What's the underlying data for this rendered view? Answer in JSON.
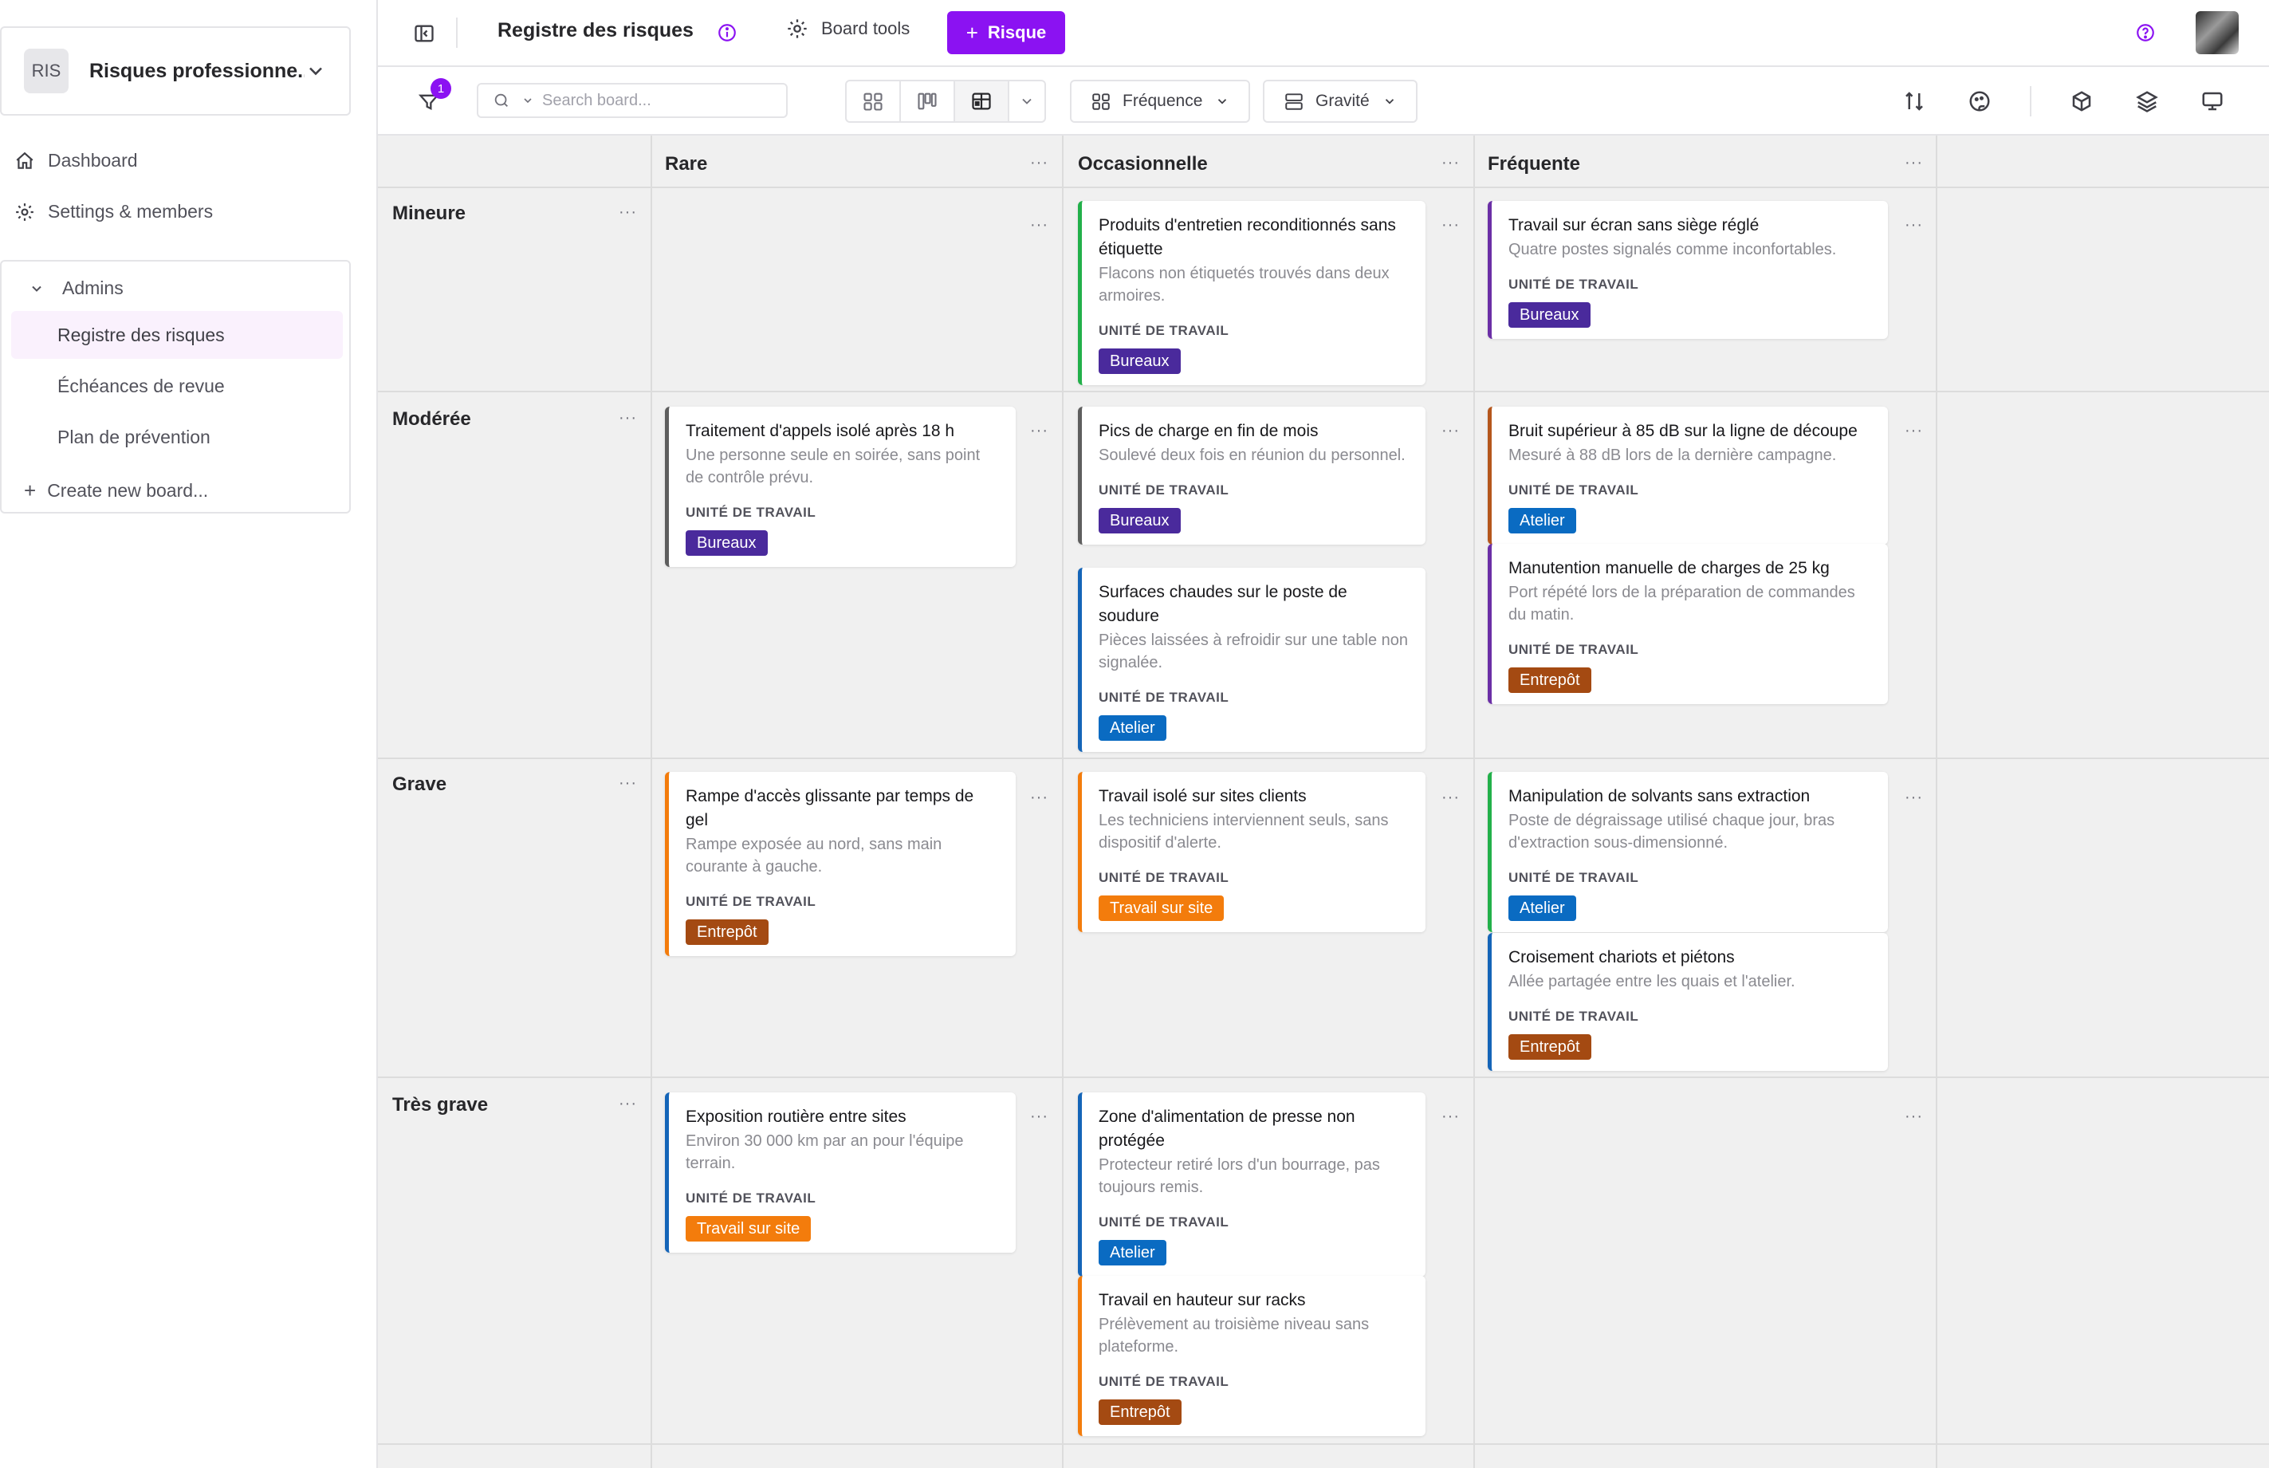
{
  "workspace": {
    "badge": "RIS",
    "name": "Risques professionne..."
  },
  "nav": {
    "dashboard": "Dashboard",
    "settings": "Settings & members"
  },
  "boards_section": {
    "heading": "Admins",
    "items": [
      "Registre des risques",
      "Échéances de revue",
      "Plan de prévention"
    ],
    "create": "Create new board..."
  },
  "topbar": {
    "title": "Registre des risques",
    "tools_label": "Board tools",
    "add_label": "Risque"
  },
  "toolbar": {
    "filter_count": "1",
    "search_placeholder": "Search board...",
    "group_columns": "Fréquence",
    "group_rows": "Gravité"
  },
  "colors": {
    "accent": "#8b12f2"
  },
  "columns": [
    "Rare",
    "Occasionnelle",
    "Fréquente"
  ],
  "rows": [
    "Mineure",
    "Modérée",
    "Grave",
    "Très grave"
  ],
  "field_label": "UNITÉ DE TRAVAIL",
  "cards": [
    {
      "title": "Produits d'entretien reconditionnés sans étiquette",
      "desc": "Flacons non étiquetés trouvés dans deux armoires.",
      "tag": "Bureaux"
    },
    {
      "title": "Travail sur écran sans siège réglé",
      "desc": "Quatre postes signalés comme inconfortables.",
      "tag": "Bureaux"
    },
    {
      "title": "Traitement d'appels isolé après 18 h",
      "desc": "Une personne seule en soirée, sans point de contrôle prévu.",
      "tag": "Bureaux"
    },
    {
      "title": "Pics de charge en fin de mois",
      "desc": "Soulevé deux fois en réunion du personnel.",
      "tag": "Bureaux"
    },
    {
      "title": "Surfaces chaudes sur le poste de soudure",
      "desc": "Pièces laissées à refroidir sur une table non signalée.",
      "tag": "Atelier"
    },
    {
      "title": "Bruit supérieur à 85 dB sur la ligne de découpe",
      "desc": "Mesuré à 88 dB lors de la dernière campagne.",
      "tag": "Atelier"
    },
    {
      "title": "Manutention manuelle de charges de 25 kg",
      "desc": "Port répété lors de la préparation de commandes du matin.",
      "tag": "Entrepôt"
    },
    {
      "title": "Rampe d'accès glissante par temps de gel",
      "desc": "Rampe exposée au nord, sans main courante à gauche.",
      "tag": "Entrepôt"
    },
    {
      "title": "Travail isolé sur sites clients",
      "desc": "Les techniciens interviennent seuls, sans dispositif d'alerte.",
      "tag": "Travail sur site"
    },
    {
      "title": "Manipulation de solvants sans extraction",
      "desc": "Poste de dégraissage utilisé chaque jour, bras d'extraction sous-dimensionné.",
      "tag": "Atelier"
    },
    {
      "title": "Croisement chariots et piétons",
      "desc": "Allée partagée entre les quais et l'atelier.",
      "tag": "Entrepôt"
    },
    {
      "title": "Exposition routière entre sites",
      "desc": "Environ 30 000 km par an pour l'équipe terrain.",
      "tag": "Travail sur site"
    },
    {
      "title": "Zone d'alimentation de presse non protégée",
      "desc": "Protecteur retiré lors d'un bourrage, pas toujours remis.",
      "tag": "Atelier"
    },
    {
      "title": "Travail en hauteur sur racks",
      "desc": "Prélèvement au troisième niveau sans plateforme.",
      "tag": "Entrepôt"
    }
  ],
  "tag_colors": {
    "Bureaux": "#4a2a9c",
    "Atelier": "#0a6bc2",
    "Entrepôt": "#a44a12",
    "Travail sur site": "#f37c0c"
  },
  "card_accent_colors": [
    "#22b04a",
    "#6b2fa6",
    "#5e5e5e",
    "#5e5e5e",
    "#1565b8",
    "#b5561c",
    "#6b2fa6",
    "#f37c0c",
    "#f37c0c",
    "#22b04a",
    "#1565b8",
    "#1565b8",
    "#1565b8",
    "#f37c0c"
  ]
}
